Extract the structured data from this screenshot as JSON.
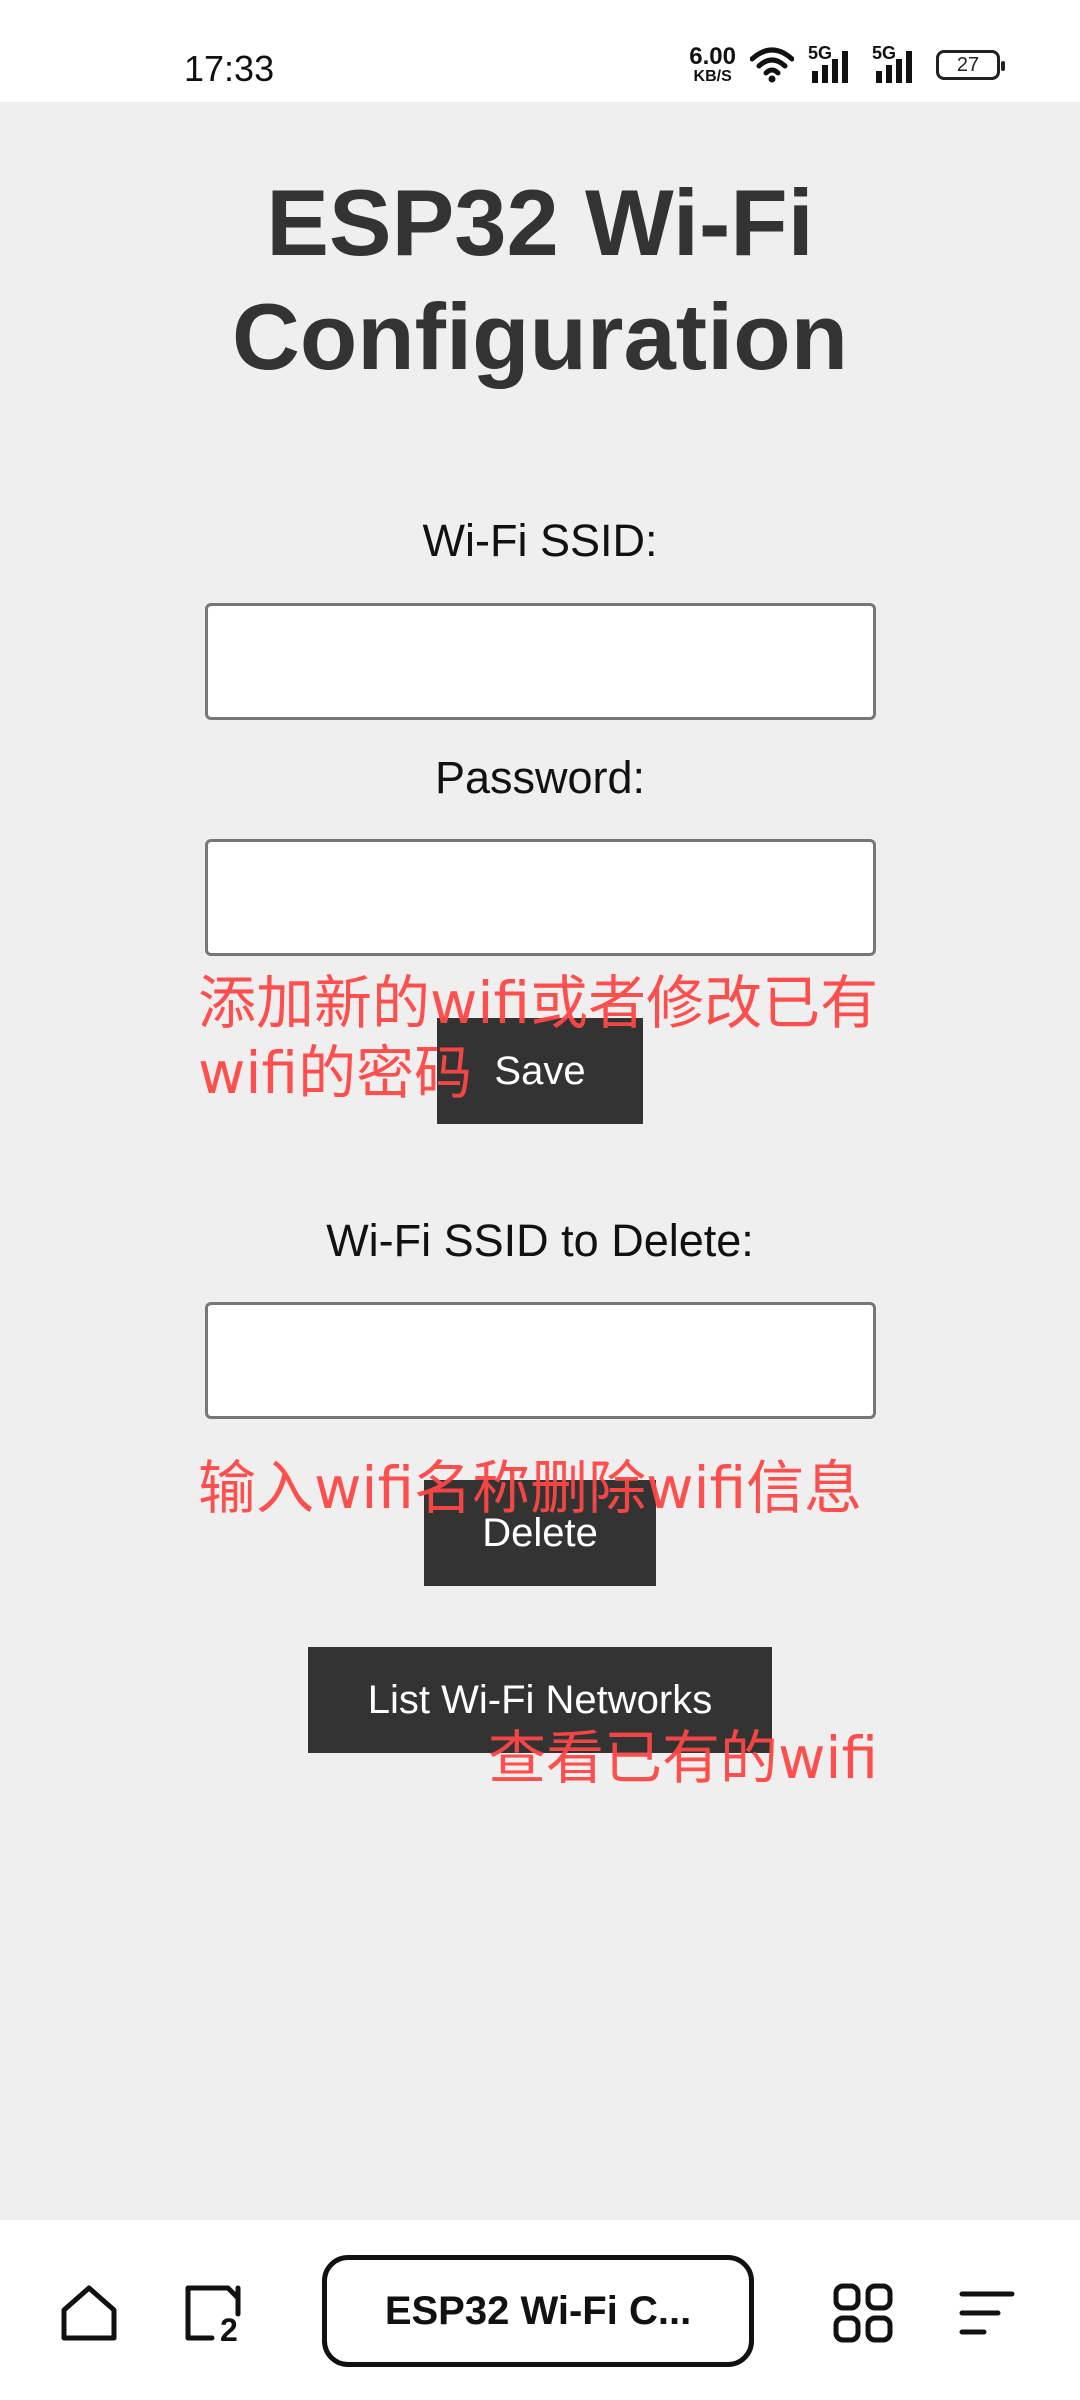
{
  "status_bar": {
    "time": "17:33",
    "net_speed_value": "6.00",
    "net_speed_unit": "KB/S",
    "signal_label_1": "5G",
    "signal_label_2": "5G",
    "battery": "27"
  },
  "page": {
    "title_line1": "ESP32 Wi-Fi",
    "title_line2": "Configuration",
    "ssid_label": "Wi-Fi SSID:",
    "ssid_value": "",
    "password_label": "Password:",
    "password_value": "",
    "save_button": "Save",
    "delete_label": "Wi-Fi SSID to Delete:",
    "delete_value": "",
    "delete_button": "Delete",
    "list_button": "List Wi-Fi Networks"
  },
  "annotations": {
    "save_note_line1": "添加新的wifi或者修改已有",
    "save_note_line2": "wifi的密码",
    "delete_note": "输入wifi名称删除wifi信息",
    "list_note": "查看已有的wifi"
  },
  "bottom_nav": {
    "home_icon": "home-icon",
    "tabs_count": "2",
    "tab_title": "ESP32 Wi-Fi C...",
    "apps_icon": "apps-grid-icon",
    "menu_icon": "menu-icon"
  }
}
